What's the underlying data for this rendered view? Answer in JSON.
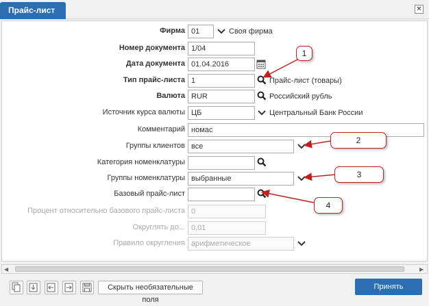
{
  "window": {
    "tab_title": "Прайс-лист",
    "close_symbol": "✕"
  },
  "form": {
    "firm": {
      "label": "Фирма",
      "value": "01",
      "name": "Своя фирма"
    },
    "doc_number": {
      "label": "Номер документа",
      "value": "1/04"
    },
    "doc_date": {
      "label": "Дата документа",
      "value": "01.04.2016"
    },
    "price_type": {
      "label": "Тип прайс-листа",
      "value": "1",
      "name": "Прайс-лист (товары)"
    },
    "currency": {
      "label": "Валюта",
      "value": "RUR",
      "name": "Российский рубль"
    },
    "rate_source": {
      "label": "Источник курса валюты",
      "value": "ЦБ",
      "name": "Центральный Банк России"
    },
    "comment": {
      "label": "Комментарий",
      "value": "номас"
    },
    "client_groups": {
      "label": "Группы клиентов",
      "value": "все"
    },
    "nom_category": {
      "label": "Категория номенклатуры",
      "value": ""
    },
    "nom_groups": {
      "label": "Группы номенклатуры",
      "value": "выбранные"
    },
    "base_price": {
      "label": "Базовый прайс-лист",
      "value": ""
    },
    "percent_base": {
      "label": "Процент относительно базового прайс-листа",
      "value": "0"
    },
    "round_to": {
      "label": "Округлять до...",
      "value": "0,01"
    },
    "round_rule": {
      "label": "Правило округления",
      "value": "арифметическое"
    }
  },
  "callouts": [
    "1",
    "2",
    "3",
    "4"
  ],
  "footer": {
    "hide_label": "Скрыть необязательные поля",
    "accept_label": "Принять"
  },
  "colors": {
    "accent": "#2b6fb2",
    "callout_border": "#c0201f"
  }
}
